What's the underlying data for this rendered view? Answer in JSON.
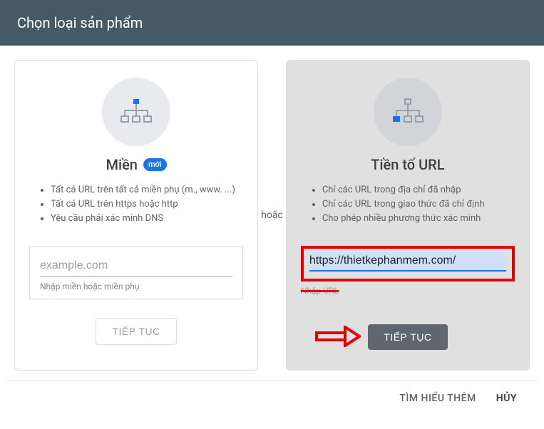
{
  "header": {
    "title": "Chọn loại sản phẩm"
  },
  "separator": "hoặc",
  "cards": {
    "domain": {
      "title": "Miền",
      "badge": "mới",
      "bullets": [
        "Tất cả URL trên tất cả miền phụ (m., www. ...)",
        "Tất cả URL trên https hoặc http",
        "Yêu cầu phải xác minh DNS"
      ],
      "placeholder": "example.com",
      "helper": "Nhập miền hoặc miền phụ",
      "button": "TIẾP TỤC"
    },
    "prefix": {
      "title": "Tiền tố URL",
      "bullets": [
        "Chỉ các URL trong địa chỉ đã nhập",
        "Chỉ các URL trong giao thức đã chỉ định",
        "Cho phép nhiều phương thức xác minh"
      ],
      "value": "https://thietkephanmem.com/",
      "helper": "Nhập URL",
      "button": "TIẾP TỤC"
    }
  },
  "footer": {
    "learn": "TÌM HIỂU THÊM",
    "cancel": "HỦY"
  },
  "annotations": {
    "highlight_color": "#e60000"
  }
}
